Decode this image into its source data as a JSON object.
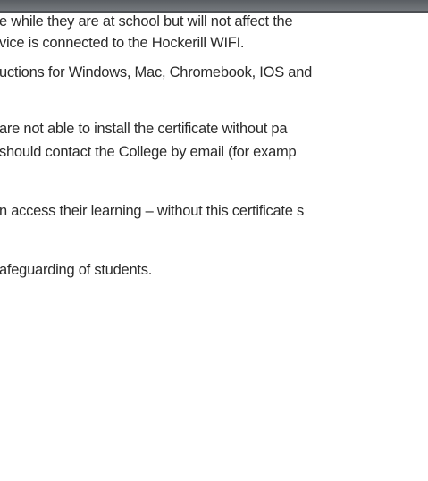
{
  "document": {
    "lines": [
      "e while they are at school but will not affect the",
      "vice is connected to the Hockerill WIFI.",
      "uctions for Windows, Mac, Chromebook, IOS and",
      "are not able to install the certificate without pa",
      "should contact the College by email (for examp",
      "n access their learning – without this certificate s",
      "afeguarding of students."
    ]
  }
}
